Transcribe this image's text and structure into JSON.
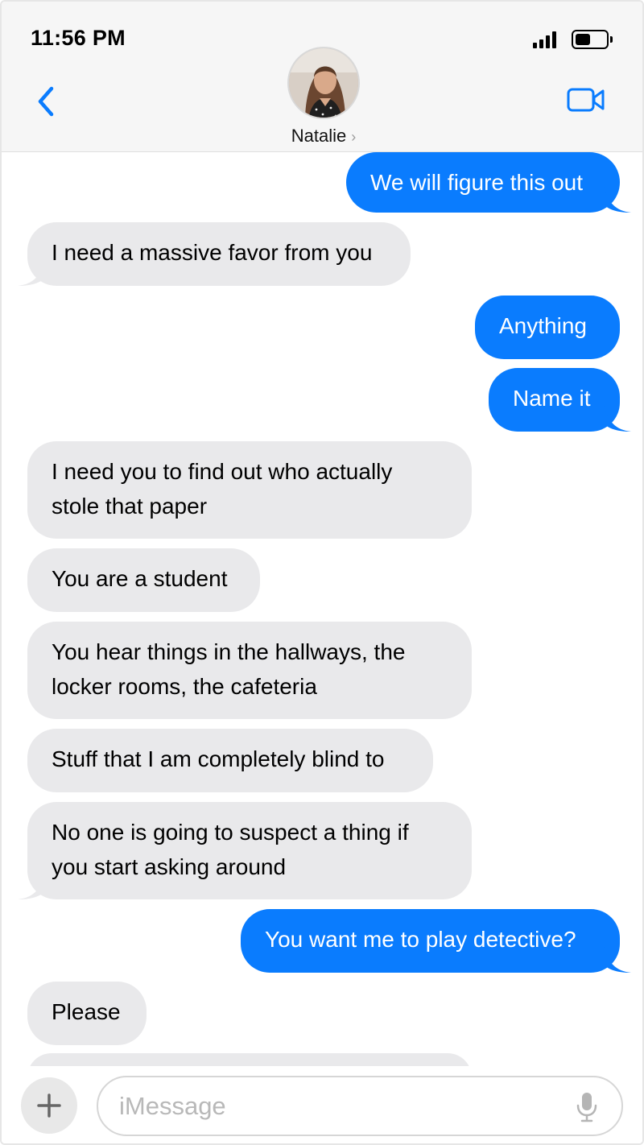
{
  "status_bar": {
    "time": "11:56 PM"
  },
  "header": {
    "contact_name": "Natalie",
    "chevron": "›"
  },
  "icons": {
    "back": "chevron-left-icon",
    "video": "video-camera-icon",
    "signal": "cellular-signal-icon",
    "battery": "battery-icon",
    "plus": "plus-icon",
    "mic": "microphone-icon"
  },
  "colors": {
    "outgoing_bubble": "#0a7cfe",
    "incoming_bubble": "#e9e9eb",
    "accent": "#0a7cfe"
  },
  "messages": [
    {
      "direction": "outgoing",
      "text": "We will figure this out"
    },
    {
      "direction": "incoming",
      "text": "I need a massive favor from you"
    },
    {
      "direction": "outgoing",
      "text": "Anything"
    },
    {
      "direction": "outgoing",
      "text": "Name it"
    },
    {
      "direction": "incoming",
      "text": "I need you to find out who actually\nstole that paper"
    },
    {
      "direction": "incoming",
      "text": "You are a student"
    },
    {
      "direction": "incoming",
      "text": "You hear things in the hallways, the\nlocker rooms, the cafeteria"
    },
    {
      "direction": "incoming",
      "text": "Stuff that I am completely blind to"
    },
    {
      "direction": "incoming",
      "text": "No one is going to suspect a thing if\nyou start asking around"
    },
    {
      "direction": "outgoing",
      "text": "You want me to play detective?"
    },
    {
      "direction": "incoming",
      "text": "Please"
    }
  ],
  "composer": {
    "placeholder": "iMessage",
    "value": ""
  }
}
